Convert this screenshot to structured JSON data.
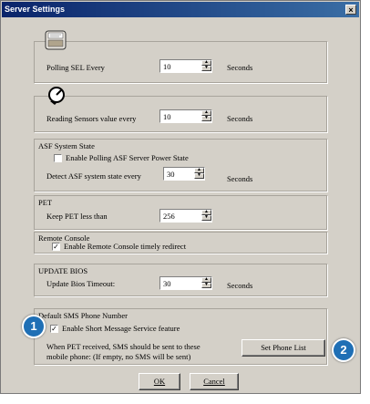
{
  "window": {
    "title": "Server Settings",
    "close_glyph": "×"
  },
  "polling": {
    "label": "Polling SEL Every",
    "value": "10",
    "unit": "Seconds",
    "icon": "sel-log-icon"
  },
  "sensor": {
    "label": "Reading Sensors value every",
    "value": "10",
    "unit": "Seconds",
    "icon": "sensor-gauge-icon"
  },
  "asf": {
    "title": "ASF System State",
    "checkbox_label": "Enable Polling ASF Server Power State",
    "checked": false,
    "detect_label": "Detect ASF system state every",
    "value": "30",
    "unit": "Seconds"
  },
  "pet": {
    "title": "PET",
    "label": "Keep PET less than",
    "value": "256"
  },
  "remote_console": {
    "title": "Remote Console",
    "checkbox_label": "Enable Remote Console timely redirect",
    "checked": true
  },
  "update_bios": {
    "title": "UPDATE BIOS",
    "label": "Update Bios Timeout:",
    "value": "30",
    "unit": "Seconds"
  },
  "sms": {
    "title": "Default SMS Phone Number",
    "checkbox_label": "Enable Short Message Service feature",
    "checked": true,
    "note_line1": "When PET received, SMS should be sent to these",
    "note_line2": "mobile phone: (If empty, no SMS will be sent)",
    "button_label": "Set Phone List"
  },
  "buttons": {
    "ok": "OK",
    "cancel": "Cancel"
  },
  "callouts": [
    "1",
    "2"
  ],
  "colors": {
    "titlebar": "#0a246a",
    "dialog": "#d4d0c8",
    "callout": "#1f6fb5"
  }
}
